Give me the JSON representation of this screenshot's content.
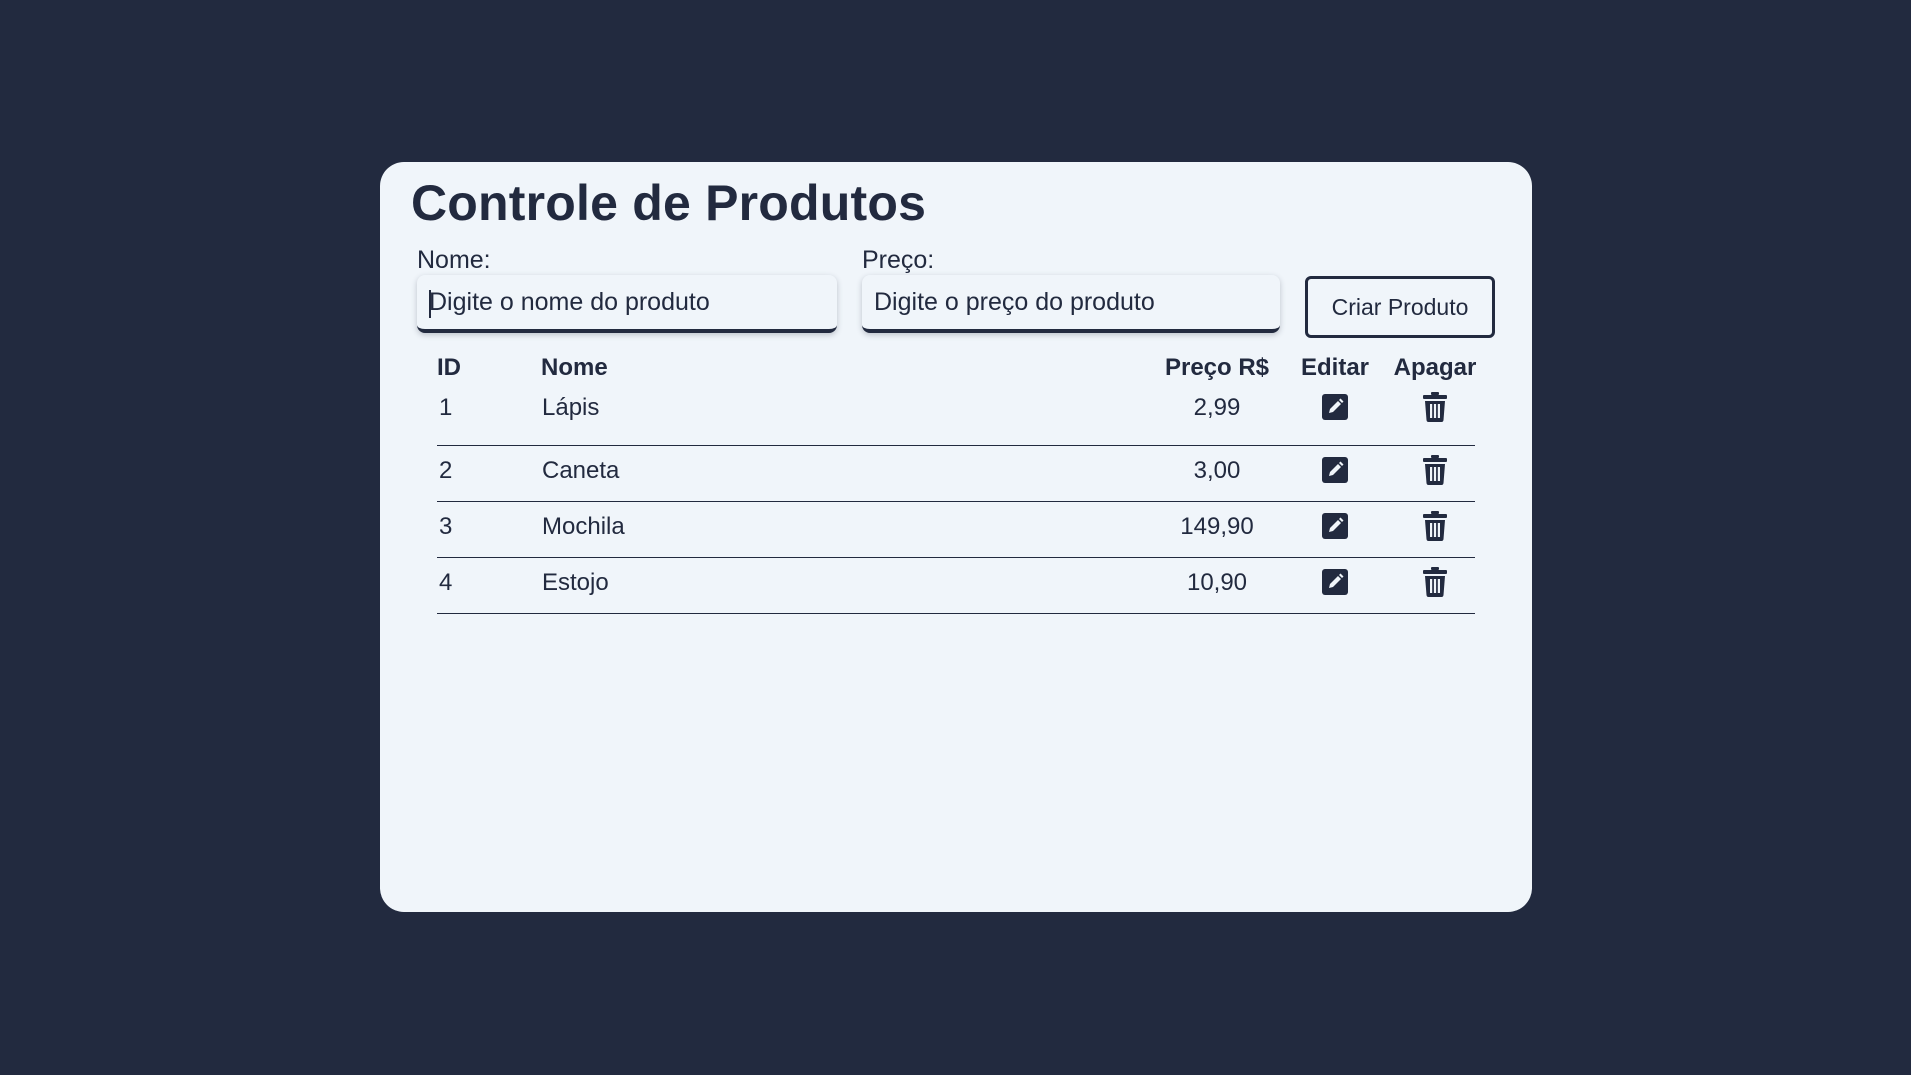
{
  "title": "Controle de Produtos",
  "form": {
    "name_label": "Nome:",
    "name_placeholder": "Digite o nome do produto",
    "price_label": "Preço:",
    "price_placeholder": "Digite o preço do produto",
    "create_button": "Criar Produto"
  },
  "table": {
    "headers": {
      "id": "ID",
      "name": "Nome",
      "price": "Preço R$",
      "edit": "Editar",
      "delete": "Apagar"
    },
    "rows": [
      {
        "id": "1",
        "name": "Lápis",
        "price": "2,99"
      },
      {
        "id": "2",
        "name": "Caneta",
        "price": "3,00"
      },
      {
        "id": "3",
        "name": "Mochila",
        "price": "149,90"
      },
      {
        "id": "4",
        "name": "Estojo",
        "price": "10,90"
      }
    ]
  },
  "icons": {
    "edit": "edit-icon",
    "delete": "trash-icon"
  },
  "colors": {
    "background": "#222a3f",
    "card": "#f0f5fa",
    "text": "#222a3f"
  }
}
